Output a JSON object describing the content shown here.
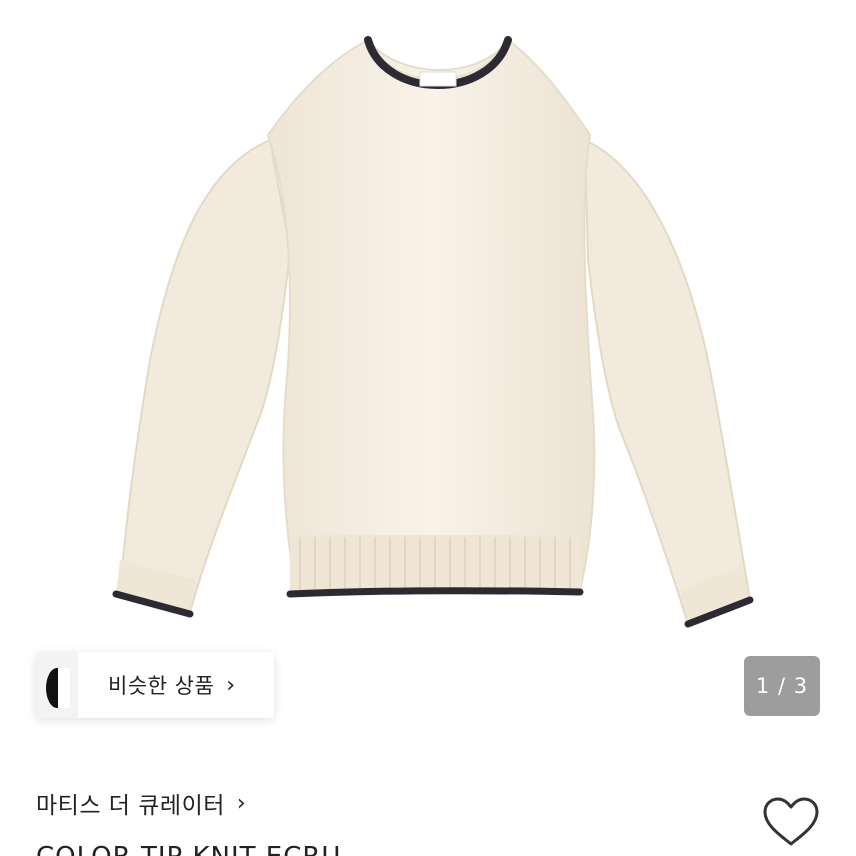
{
  "product": {
    "image_alt": "color tip knit sweater",
    "seller_name": "마티스 더 큐레이터",
    "title": "COLOR TIP KNIT ECRU"
  },
  "similar_items": {
    "label": "비슷한 상품",
    "chevron": "›"
  },
  "seller": {
    "chevron": "›"
  },
  "gallery": {
    "counter": "1 / 3"
  },
  "icons": {
    "like": "heart-outline-icon",
    "chevron": "chevron-right-icon"
  },
  "colors": {
    "sweater": "#f5eee2",
    "trim": "#2e2a33",
    "counter_bg": "#9d9d9d"
  }
}
